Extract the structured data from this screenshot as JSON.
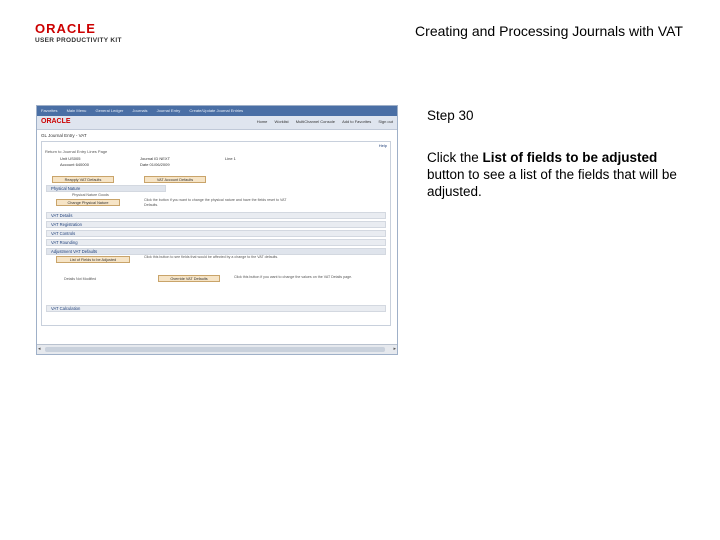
{
  "brand": {
    "logo_top": "ORACLE",
    "logo_bottom": "USER PRODUCTIVITY KIT"
  },
  "document": {
    "title": "Creating and Processing Journals with VAT"
  },
  "step": {
    "label": "Step 30",
    "instruction_pre": "Click the ",
    "instruction_bold": "List of fields to be adjusted",
    "instruction_post": " button to see a list of the fields that will be adjusted."
  },
  "screenshot": {
    "menu_items": [
      "Favorites",
      "Main Menu",
      "General Ledger",
      "Journals",
      "Journal Entry",
      "Create/Update Journal Entries"
    ],
    "app_logo": "ORACLE",
    "nav_links": [
      "Home",
      "Worklist",
      "MultiChannel Console",
      "Add to Favorites",
      "Sign out"
    ],
    "breadcrumb": "GL Journal Entry - VAT",
    "help": "Help",
    "hint": "Return to Journal Entry Lines Page",
    "fields": [
      "Unit US005",
      "Journal ID NEXT",
      "Line 1",
      "Account 640000",
      "Date 01/06/2009"
    ],
    "btn_reapply": "Reapply VAT Defaults",
    "btn_vat_account": "VAT Account Defaults",
    "sections": {
      "physical_nature": "Physical Nature",
      "physical_nature_value": "Physical Nature Goods",
      "btn_change_physical": "Change Physical Nature",
      "physical_note": "Click the button if you want to change the physical nature and have the fields reset to VAT Defaults.",
      "vat_details": "VAT Details",
      "vat_registration": "VAT Registration",
      "vat_controls": "VAT Controls",
      "vat_rounding": "VAT Rounding",
      "adjustment_defaults": "Adjustment VAT Defaults",
      "btn_list_fields": "List of Fields to be Adjusted",
      "adjust_note": "Click this button to see fields that would be affected by a change to the VAT defaults.",
      "details_label": "Details Not Modified",
      "btn_override": "Override VAT Defaults",
      "override_note": "Click this button if you want to change the values on the VAT Details page.",
      "vat_calculation": "VAT Calculation"
    }
  }
}
